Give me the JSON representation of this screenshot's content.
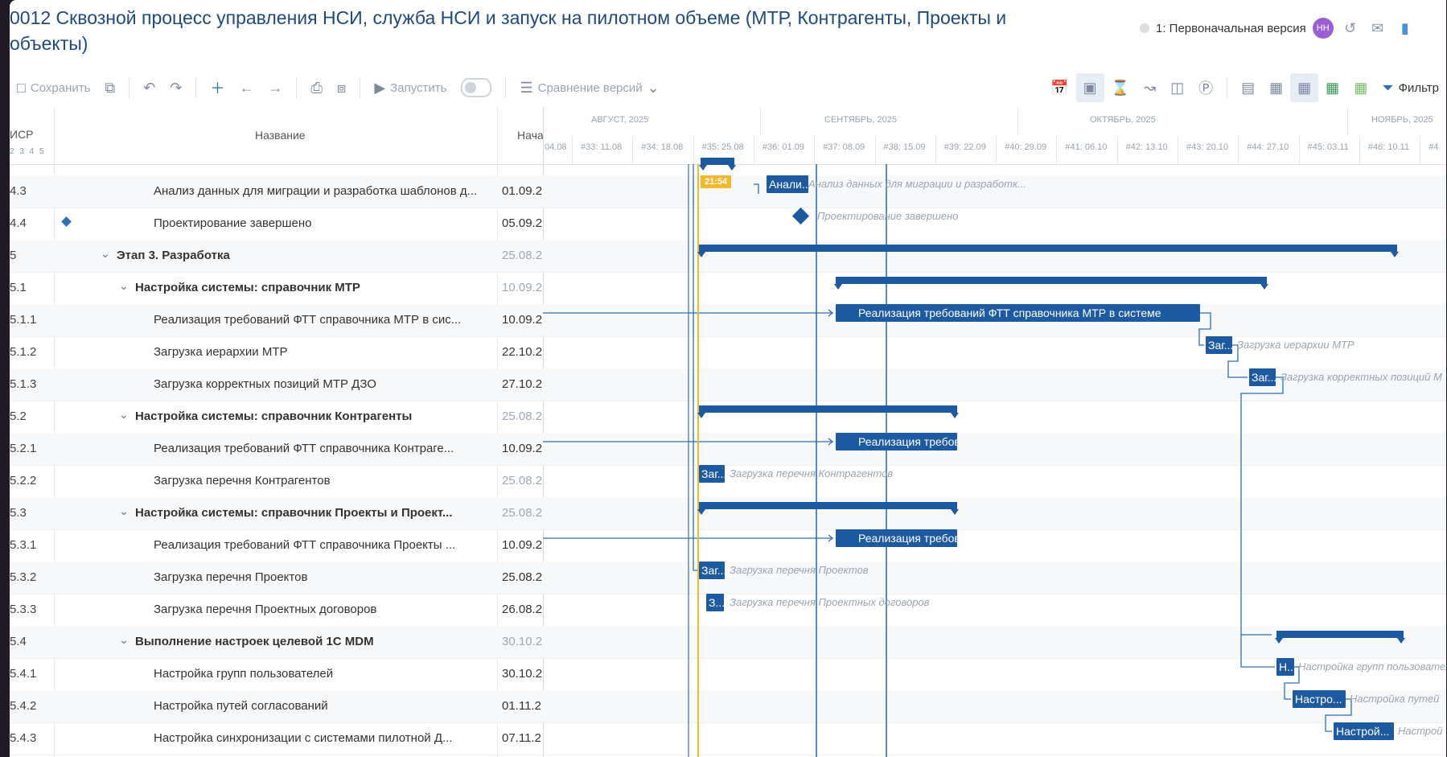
{
  "header": {
    "title": "0012 Сквозной процесс управления НСИ, служба НСИ и запуск на пилотном объеме (МТР, Контрагенты, Проекты и объекты)",
    "version_label": "1: Первоначальная версия",
    "avatar_initials": "НН"
  },
  "toolbar": {
    "save_label": "Сохранить",
    "run_label": "Запустить",
    "compare_label": "Сравнение версий",
    "filter_label": "Фильтр"
  },
  "grid": {
    "col_wbs": "ИСР",
    "col_levels": "2 3 4 5",
    "col_name": "Название",
    "col_start": "Нача"
  },
  "timeline": {
    "months": [
      "АВГУСТ, 2025",
      "СЕНТЯБРЬ, 2025",
      "ОКТЯБРЬ, 2025",
      "НОЯБРЬ, 2025"
    ],
    "weeks": [
      "04.08",
      "#33: 11.08",
      "#34: 18.08",
      "#35: 25.08",
      "#36: 01.09",
      "#37: 08.09",
      "#38: 15.09",
      "#39: 22.09",
      "#40: 29.09",
      "#41: 06.10",
      "#42: 13.10",
      "#43: 20.10",
      "#44: 27.10",
      "#45: 03.11",
      "#46: 10.11",
      "#4"
    ],
    "now_label": "21:54"
  },
  "rows": [
    {
      "wbs": "4.3",
      "name": "Анализ данных для миграции и разработка шаблонов д...",
      "start": "01.09.2",
      "bold": false,
      "indent": 2,
      "bar_label": "Анали...",
      "side_label": "Анализ данных для миграции и разработк..."
    },
    {
      "wbs": "4.4",
      "name": "Проектирование завершено",
      "start": "05.09.2",
      "bold": false,
      "indent": 2,
      "side_label": "Проектирование завершено"
    },
    {
      "wbs": "5",
      "name": "Этап 3. Разработка",
      "start": "25.08.2",
      "bold": true,
      "indent": 0
    },
    {
      "wbs": "5.1",
      "name": "Настройка системы: справочник МТР",
      "start": "10.09.2",
      "bold": true,
      "indent": 1
    },
    {
      "wbs": "5.1.1",
      "name": "Реализация требований ФТТ справочника МТР в сис...",
      "start": "10.09.2",
      "bold": false,
      "indent": 2,
      "bar_label": "Реализация требований ФТТ справочника МТР в системе"
    },
    {
      "wbs": "5.1.2",
      "name": "Загрузка иерархии МТР",
      "start": "22.10.2",
      "bold": false,
      "indent": 2,
      "bar_label": "Заг...",
      "side_label": "Загрузка иерархии МТР"
    },
    {
      "wbs": "5.1.3",
      "name": "Загрузка корректных позиций МТР ДЗО",
      "start": "27.10.2",
      "bold": false,
      "indent": 2,
      "bar_label": "Заг...",
      "side_label": "Загрузка корректных позиций М"
    },
    {
      "wbs": "5.2",
      "name": "Настройка системы: справочник Контрагенты",
      "start": "25.08.2",
      "bold": true,
      "indent": 1
    },
    {
      "wbs": "5.2.1",
      "name": "Реализация требований ФТТ справочника Контраге...",
      "start": "10.09.2",
      "bold": false,
      "indent": 2,
      "bar_label": "Реализация требов..."
    },
    {
      "wbs": "5.2.2",
      "name": "Загрузка перечня Контрагентов",
      "start": "25.08.2",
      "bold": false,
      "indent": 2,
      "bar_label": "Заг...",
      "side_label": "Загрузка перечня Контрагентов"
    },
    {
      "wbs": "5.3",
      "name": "Настройка системы: справочник Проекты и Проект...",
      "start": "25.08.2",
      "bold": true,
      "indent": 1
    },
    {
      "wbs": "5.3.1",
      "name": "Реализация требований ФТТ справочника Проекты ...",
      "start": "10.09.2",
      "bold": false,
      "indent": 2,
      "bar_label": "Реализация требов..."
    },
    {
      "wbs": "5.3.2",
      "name": "Загрузка перечня Проектов",
      "start": "25.08.2",
      "bold": false,
      "indent": 2,
      "bar_label": "Заг...",
      "side_label": "Загрузка перечня Проектов"
    },
    {
      "wbs": "5.3.3",
      "name": "Загрузка перечня Проектных договоров",
      "start": "26.08.2",
      "bold": false,
      "indent": 2,
      "bar_label": "З...",
      "side_label": "Загрузка перечня Проектных договоров"
    },
    {
      "wbs": "5.4",
      "name": "Выполнение настроек целевой 1С MDM",
      "start": "30.10.2",
      "bold": true,
      "indent": 1
    },
    {
      "wbs": "5.4.1",
      "name": "Настройка групп пользователей",
      "start": "30.10.2",
      "bold": false,
      "indent": 2,
      "bar_label": "Н...",
      "side_label": "Настройка групп пользовател"
    },
    {
      "wbs": "5.4.2",
      "name": "Настройка путей согласований",
      "start": "01.11.2",
      "bold": false,
      "indent": 2,
      "bar_label": "Настро...",
      "side_label": "Настройка путей"
    },
    {
      "wbs": "5.4.3",
      "name": "Настройка синхронизации с системами пилотной Д...",
      "start": "07.11.2",
      "bold": false,
      "indent": 2,
      "bar_label": "Настрой...",
      "side_label": "Настрой"
    }
  ],
  "colors": {
    "accent": "#1e5aa0",
    "now_line": "#f4b830",
    "title": "#1f4a7a"
  }
}
